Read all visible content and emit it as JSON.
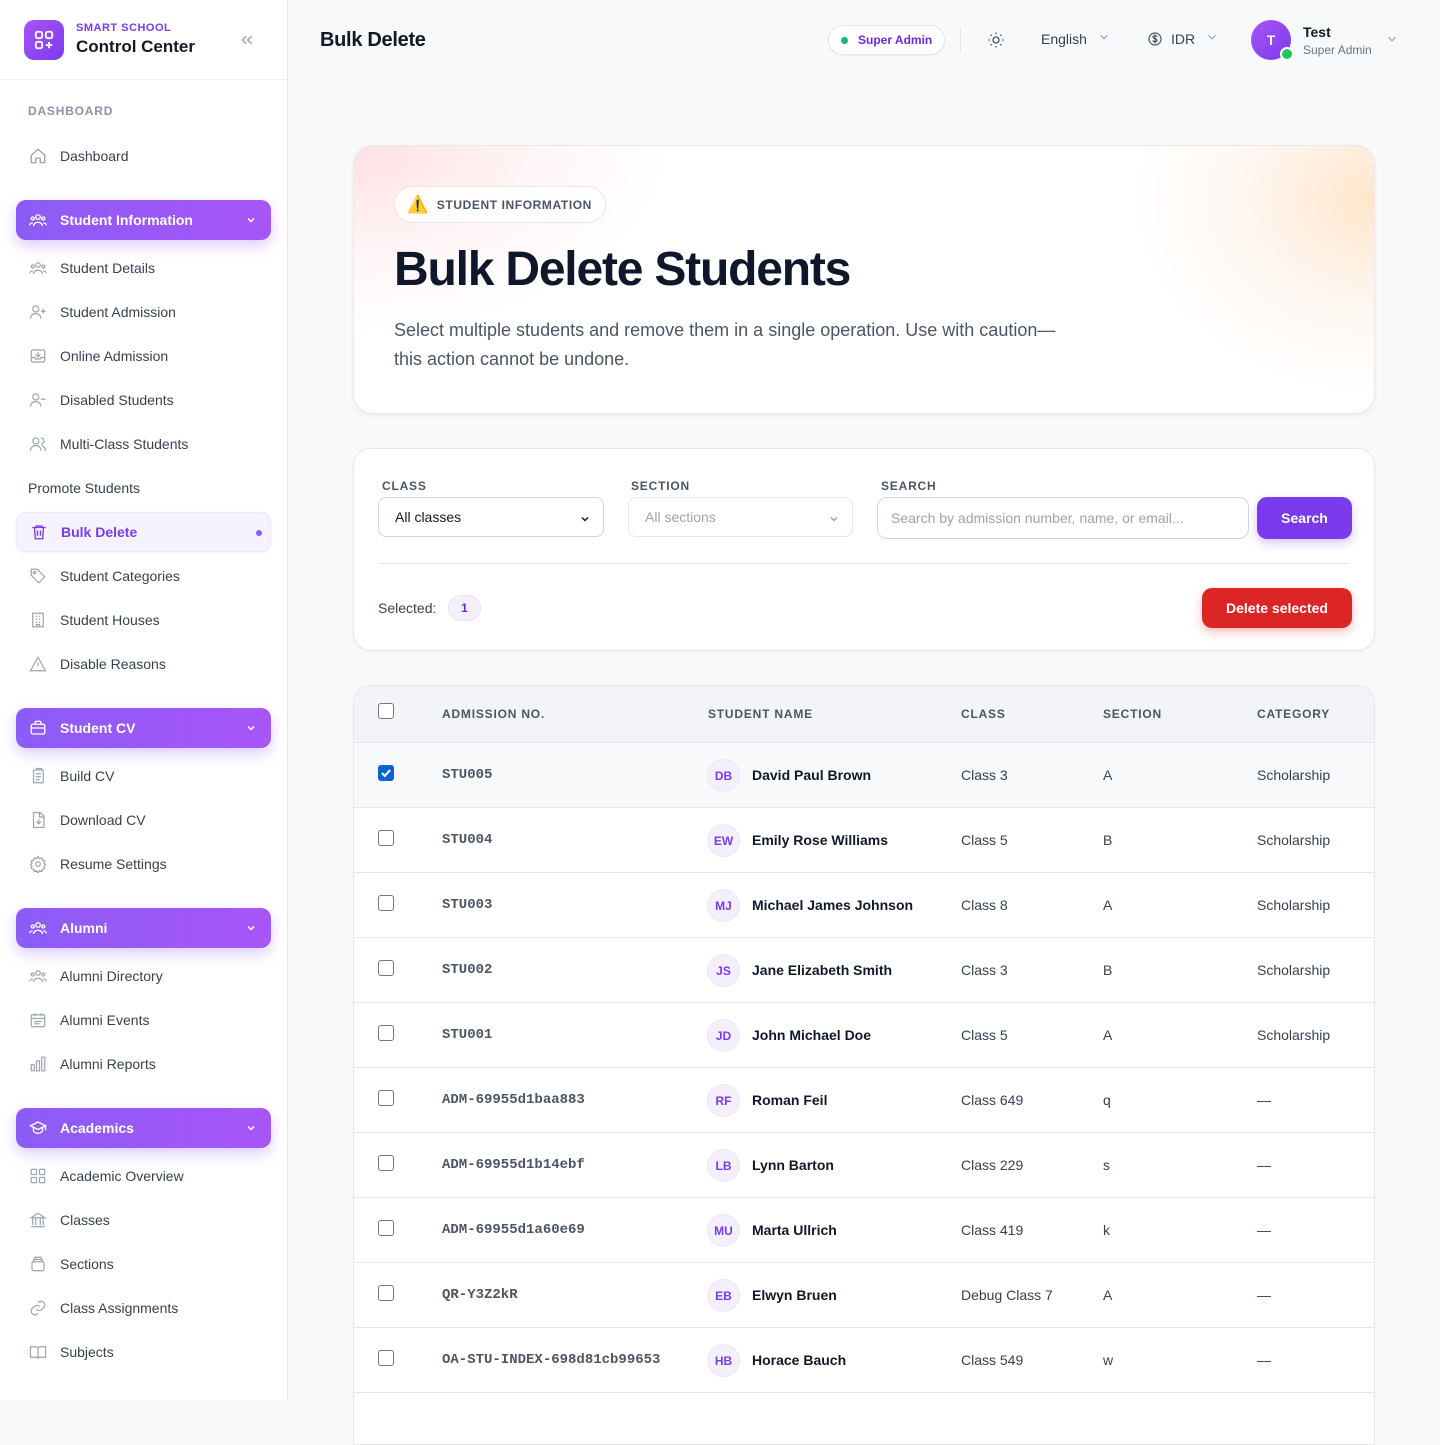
{
  "brand": {
    "subtitle": "SMART SCHOOL",
    "title": "Control Center"
  },
  "sidebar": {
    "heading": "DASHBOARD",
    "dashboard": "Dashboard",
    "groups": {
      "student_information": {
        "label": "Student Information",
        "items": [
          "Student Details",
          "Student Admission",
          "Online Admission",
          "Disabled Students",
          "Multi-Class Students",
          "Promote Students",
          "Bulk Delete",
          "Student Categories",
          "Student Houses",
          "Disable Reasons"
        ]
      },
      "student_cv": {
        "label": "Student CV",
        "items": [
          "Build CV",
          "Download CV",
          "Resume Settings"
        ]
      },
      "alumni": {
        "label": "Alumni",
        "items": [
          "Alumni Directory",
          "Alumni Events",
          "Alumni Reports"
        ]
      },
      "academics": {
        "label": "Academics",
        "items": [
          "Academic Overview",
          "Classes",
          "Sections",
          "Class Assignments",
          "Subjects"
        ]
      }
    }
  },
  "header": {
    "title": "Bulk Delete",
    "role_badge": "Super Admin",
    "language": "English",
    "currency": "IDR",
    "user": {
      "initial": "T",
      "name": "Test",
      "role": "Super Admin"
    }
  },
  "hero": {
    "badge": "STUDENT INFORMATION",
    "title": "Bulk Delete Students",
    "description": "Select multiple students and remove them in a single operation. Use with caution—this action cannot be undone."
  },
  "filters": {
    "class_label": "CLASS",
    "class_value": "All classes",
    "section_label": "SECTION",
    "section_value": "All sections",
    "search_label": "SEARCH",
    "search_placeholder": "Search by admission number, name, or email...",
    "search_button": "Search",
    "selected_label": "Selected:",
    "selected_count": "1",
    "delete_button": "Delete selected"
  },
  "table": {
    "headers": {
      "admission": "ADMISSION NO.",
      "name": "STUDENT NAME",
      "class": "CLASS",
      "section": "SECTION",
      "category": "CATEGORY"
    },
    "rows": [
      {
        "checked": true,
        "admission": "STU005",
        "initials": "DB",
        "name": "David Paul Brown",
        "class": "Class 3",
        "section": "A",
        "category": "Scholarship"
      },
      {
        "checked": false,
        "admission": "STU004",
        "initials": "EW",
        "name": "Emily Rose Williams",
        "class": "Class 5",
        "section": "B",
        "category": "Scholarship"
      },
      {
        "checked": false,
        "admission": "STU003",
        "initials": "MJ",
        "name": "Michael James Johnson",
        "class": "Class 8",
        "section": "A",
        "category": "Scholarship"
      },
      {
        "checked": false,
        "admission": "STU002",
        "initials": "JS",
        "name": "Jane Elizabeth Smith",
        "class": "Class 3",
        "section": "B",
        "category": "Scholarship"
      },
      {
        "checked": false,
        "admission": "STU001",
        "initials": "JD",
        "name": "John Michael Doe",
        "class": "Class 5",
        "section": "A",
        "category": "Scholarship"
      },
      {
        "checked": false,
        "admission": "ADM-69955d1baa883",
        "initials": "RF",
        "name": "Roman Feil",
        "class": "Class 649",
        "section": "q",
        "category": "—"
      },
      {
        "checked": false,
        "admission": "ADM-69955d1b14ebf",
        "initials": "LB",
        "name": "Lynn Barton",
        "class": "Class 229",
        "section": "s",
        "category": "—"
      },
      {
        "checked": false,
        "admission": "ADM-69955d1a60e69",
        "initials": "MU",
        "name": "Marta Ullrich",
        "class": "Class 419",
        "section": "k",
        "category": "—"
      },
      {
        "checked": false,
        "admission": "QR-Y3Z2kR",
        "initials": "EB",
        "name": "Elwyn Bruen",
        "class": "Debug Class 7",
        "section": "A",
        "category": "—"
      },
      {
        "checked": false,
        "admission": "OA-STU-INDEX-698d81cb99653",
        "initials": "HB",
        "name": "Horace Bauch",
        "class": "Class 549",
        "section": "w",
        "category": "—"
      }
    ]
  }
}
